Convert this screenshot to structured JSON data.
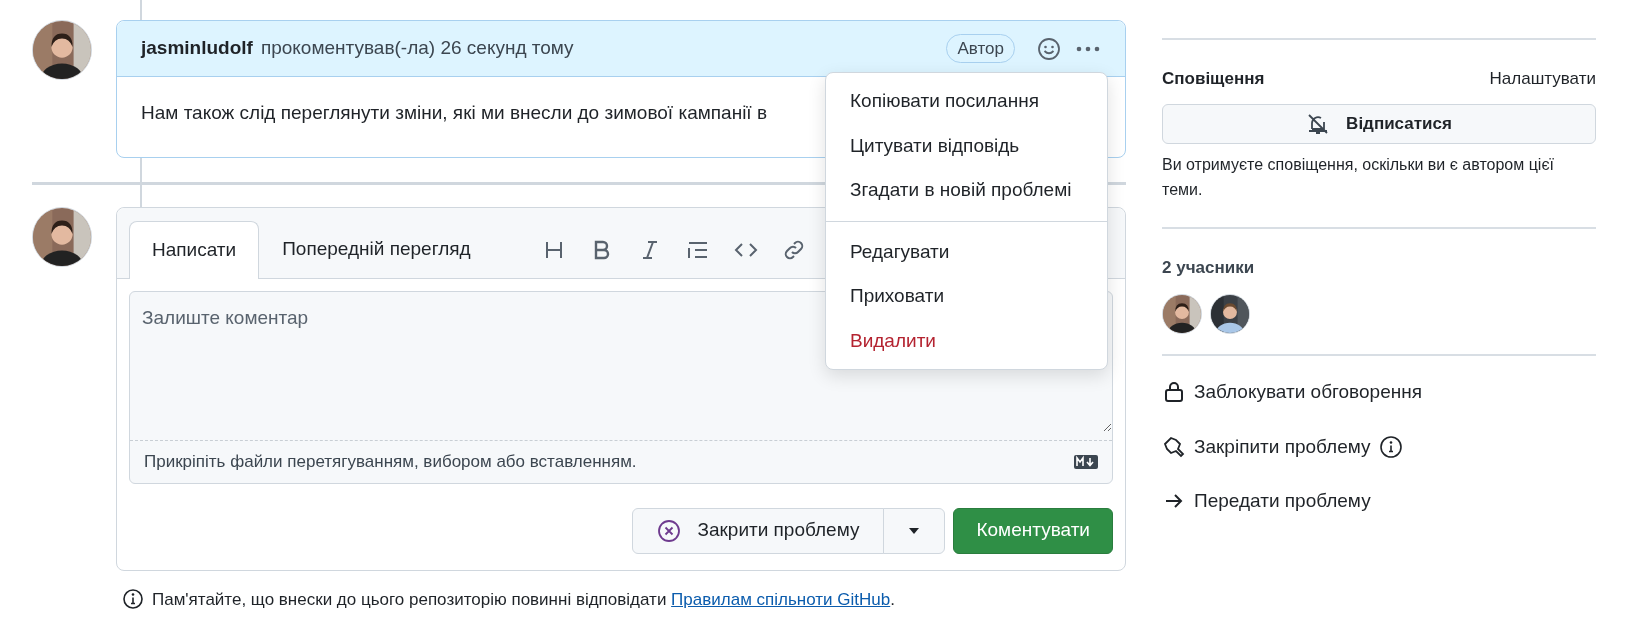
{
  "comment": {
    "author": "jasminludolf",
    "action": "прокоментував(-ла) 26 секунд тому",
    "badge": "Автор",
    "body": "Нам також слід переглянути зміни, які ми внесли до зимової кампанії в"
  },
  "comment_menu": {
    "groups": [
      [
        {
          "label": "Копіювати посилання",
          "kind": "normal"
        },
        {
          "label": "Цитувати відповідь",
          "kind": "normal"
        },
        {
          "label": "Згадати в новій проблемі",
          "kind": "normal"
        }
      ],
      [
        {
          "label": "Редагувати",
          "kind": "normal"
        },
        {
          "label": "Приховати",
          "kind": "normal"
        },
        {
          "label": "Видалити",
          "kind": "danger"
        }
      ]
    ]
  },
  "editor": {
    "tabs": [
      {
        "label": "Написати",
        "selected": true
      },
      {
        "label": "Попередній перегляд",
        "selected": false
      }
    ],
    "toolbar": [
      {
        "kind": "heading"
      },
      {
        "kind": "bold"
      },
      {
        "kind": "italic"
      },
      {
        "kind": "list"
      },
      {
        "kind": "code"
      },
      {
        "kind": "link"
      }
    ],
    "placeholder": "Залиште коментар",
    "attach_hint": "Прикріпіть файли перетягуванням, вибором або вставленням.",
    "close_button": "Закрити проблему",
    "comment_button": "Коментувати"
  },
  "footnote": {
    "text": "Пам'ятайте, що внески до цього репозиторію повинні відповідати ",
    "link": "Правилам спільноти GitHub",
    "end": "."
  },
  "sidebar": {
    "notifications": {
      "title": "Сповіщення",
      "customize": "Налаштувати",
      "button": "Відписатися",
      "note": "Ви отримуєте сповіщення, оскільки ви є автором цієї теми."
    },
    "participants": {
      "title": "2 учасники"
    },
    "actions": [
      {
        "label": "Заблокувати обговорення",
        "kind": "lock",
        "info": false
      },
      {
        "label": "Закріпити проблему",
        "kind": "pin",
        "info": true
      },
      {
        "label": "Передати проблему",
        "kind": "arrow",
        "info": false
      }
    ]
  }
}
